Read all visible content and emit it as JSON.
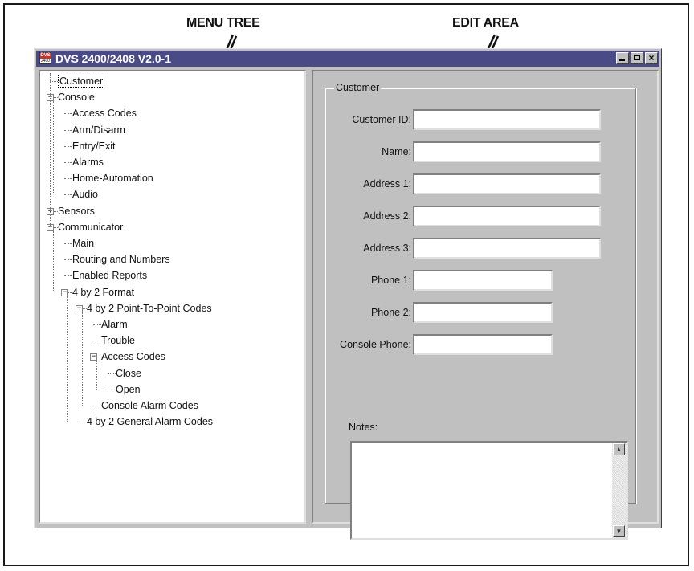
{
  "callouts": {
    "menu_tree": "MENU TREE",
    "edit_area": "EDIT AREA"
  },
  "window": {
    "title": "DVS 2400/2408 V2.0-1",
    "icon_top": "DVS",
    "icon_bottom": "2400",
    "buttons": [
      "minimize-icon",
      "maximize-icon",
      "close-icon"
    ],
    "title_bar_color": "#4a4a86"
  },
  "tree": {
    "items": [
      {
        "label": "Customer",
        "selected": true
      },
      {
        "label": "Console",
        "expander": "minus"
      },
      {
        "label": "Access Codes"
      },
      {
        "label": "Arm/Disarm"
      },
      {
        "label": "Entry/Exit"
      },
      {
        "label": "Alarms"
      },
      {
        "label": "Home-Automation"
      },
      {
        "label": "Audio"
      },
      {
        "label": "Sensors",
        "expander": "plus"
      },
      {
        "label": "Communicator",
        "expander": "minus"
      },
      {
        "label": "Main"
      },
      {
        "label": "Routing and Numbers"
      },
      {
        "label": "Enabled Reports"
      },
      {
        "label": "4 by 2 Format",
        "expander": "minus"
      },
      {
        "label": "4 by 2 Point-To-Point Codes",
        "expander": "minus"
      },
      {
        "label": "Alarm"
      },
      {
        "label": "Trouble"
      },
      {
        "label": "Access Codes",
        "expander": "minus"
      },
      {
        "label": "Close"
      },
      {
        "label": "Open"
      },
      {
        "label": "Console Alarm Codes"
      },
      {
        "label": "4 by 2 General Alarm Codes"
      }
    ]
  },
  "edit": {
    "group_title": "Customer",
    "fields": [
      {
        "label": "Customer ID:",
        "value": ""
      },
      {
        "label": "Name:",
        "value": ""
      },
      {
        "label": "Address 1:",
        "value": ""
      },
      {
        "label": "Address 2:",
        "value": ""
      },
      {
        "label": "Address 3:",
        "value": ""
      },
      {
        "label": "Phone 1:",
        "value": ""
      },
      {
        "label": "Phone 2:",
        "value": ""
      },
      {
        "label": "Console Phone:",
        "value": ""
      }
    ],
    "notes_label": "Notes:",
    "notes_value": ""
  }
}
